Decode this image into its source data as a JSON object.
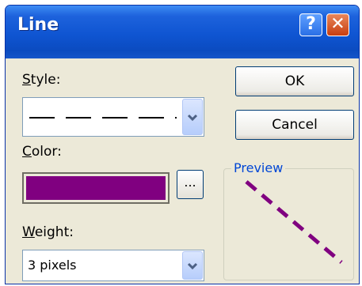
{
  "dialog": {
    "title": "Line",
    "help_glyph": "?",
    "close_glyph": "✕"
  },
  "style": {
    "label_accel": "S",
    "label_rest": "tyle:",
    "selected": "dashed"
  },
  "color": {
    "label_accel": "C",
    "label_rest": "olor:",
    "value": "#800080",
    "more_label": "..."
  },
  "weight": {
    "label_accel": "W",
    "label_rest": "eight:",
    "value": "3 pixels"
  },
  "buttons": {
    "ok": "OK",
    "cancel": "Cancel"
  },
  "preview": {
    "label": "Preview",
    "line_color": "#800080"
  },
  "icons": {
    "dropdown": "chevron-down-icon"
  }
}
